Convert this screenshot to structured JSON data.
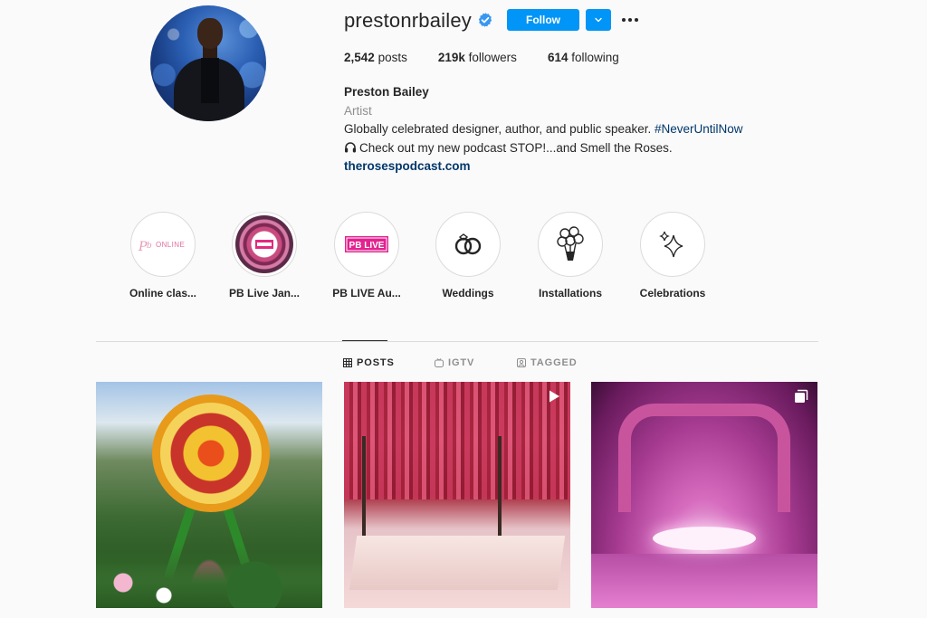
{
  "profile": {
    "username": "prestonrbailey",
    "follow_label": "Follow",
    "stats": {
      "posts_count": "2,542",
      "posts_label": "posts",
      "followers_count": "219k",
      "followers_label": "followers",
      "following_count": "614",
      "following_label": "following"
    },
    "full_name": "Preston Bailey",
    "category": "Artist",
    "bio_line1": "Globally celebrated designer, author, and public speaker. ",
    "bio_hashtag": "#NeverUntilNow",
    "bio_line2": "Check out my new podcast STOP!...and Smell the Roses.",
    "website": "therosespodcast.com"
  },
  "highlights": [
    {
      "label": "Online clas...",
      "icon": "online-classes-logo"
    },
    {
      "label": "PB Live Jan...",
      "icon": "flower-wreath-image"
    },
    {
      "label": "PB LIVE Au...",
      "icon": "pb-live-logo"
    },
    {
      "label": "Weddings",
      "icon": "wedding-rings-icon"
    },
    {
      "label": "Installations",
      "icon": "flower-bouquet-icon"
    },
    {
      "label": "Celebrations",
      "icon": "sparkles-icon"
    }
  ],
  "highlight_logo_text": {
    "online": "ONLINE",
    "pb_live": "PB LIVE"
  },
  "tabs": [
    {
      "label": "POSTS",
      "icon": "grid-icon",
      "active": true
    },
    {
      "label": "IGTV",
      "icon": "igtv-icon",
      "active": false
    },
    {
      "label": "TAGGED",
      "icon": "tagged-icon",
      "active": false
    }
  ],
  "colors": {
    "accent": "#0095f6",
    "verified": "#3897f0",
    "link": "#00376b",
    "muted": "#8e8e8e",
    "background": "#fafafa"
  },
  "posts": [
    {
      "kind": "image",
      "subject": "ferris wheel floral installation"
    },
    {
      "kind": "video",
      "subject": "red floral ceiling dining room"
    },
    {
      "kind": "carousel",
      "subject": "pink event ballroom"
    }
  ]
}
